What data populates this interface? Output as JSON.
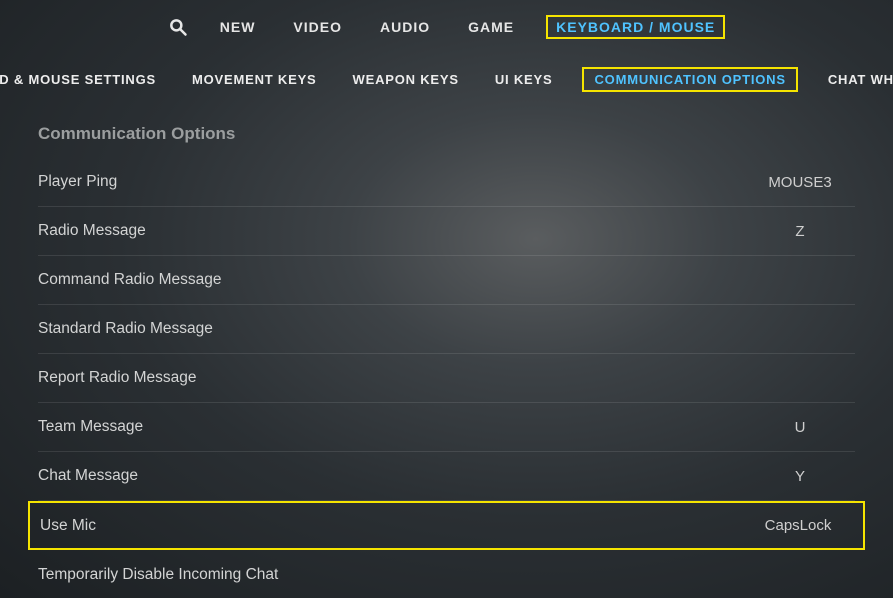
{
  "topnav": {
    "items": [
      {
        "label": "NEW"
      },
      {
        "label": "VIDEO"
      },
      {
        "label": "AUDIO"
      },
      {
        "label": "GAME"
      },
      {
        "label": "KEYBOARD / MOUSE",
        "active": true
      }
    ]
  },
  "subnav": {
    "items": [
      {
        "label": "KEYBOARD & MOUSE SETTINGS"
      },
      {
        "label": "MOVEMENT KEYS"
      },
      {
        "label": "WEAPON KEYS"
      },
      {
        "label": "UI KEYS"
      },
      {
        "label": "COMMUNICATION OPTIONS",
        "active": true
      },
      {
        "label": "CHAT WHEEL KEYS"
      }
    ]
  },
  "section": {
    "title": "Communication Options",
    "bindings": [
      {
        "label": "Player Ping",
        "value": "MOUSE3"
      },
      {
        "label": "Radio Message",
        "value": "Z"
      },
      {
        "label": "Command Radio Message",
        "value": ""
      },
      {
        "label": "Standard Radio Message",
        "value": ""
      },
      {
        "label": "Report Radio Message",
        "value": ""
      },
      {
        "label": "Team Message",
        "value": "U"
      },
      {
        "label": "Chat Message",
        "value": "Y"
      },
      {
        "label": "Use Mic",
        "value": "CapsLock",
        "highlight": true
      },
      {
        "label": "Temporarily Disable Incoming Chat",
        "value": ""
      }
    ]
  }
}
